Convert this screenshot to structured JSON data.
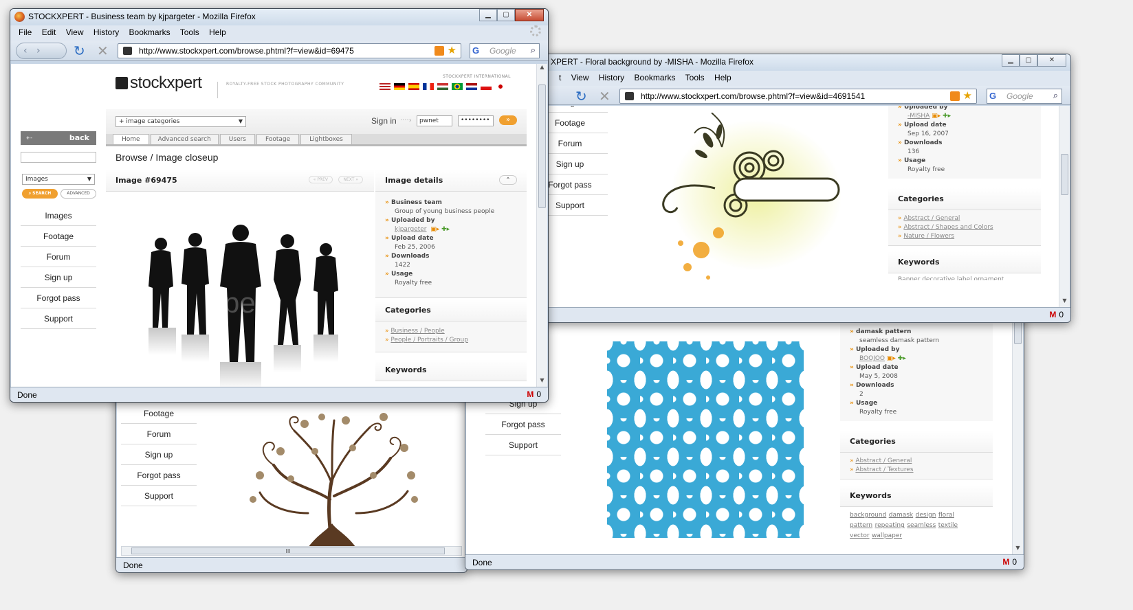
{
  "windows": {
    "bottom_left": {
      "status": "Done",
      "leftnav": [
        "Footage",
        "Forum",
        "Sign up",
        "Forgot pass",
        "Support"
      ],
      "hscroll_grip": "III"
    },
    "bottom_right": {
      "status": "Done",
      "gmail_count": "0",
      "leftnav": [
        "Sign up",
        "Forgot pass",
        "Support"
      ],
      "details": {
        "title": "damask pattern",
        "description": "seamless damask pattern",
        "uploaded_by_label": "Uploaded by",
        "uploaded_by": "BOOJOO",
        "upload_date_label": "Upload date",
        "upload_date": "May 5, 2008",
        "downloads_label": "Downloads",
        "downloads": "2",
        "usage_label": "Usage",
        "usage": "Royalty free"
      },
      "categories_title": "Categories",
      "categories": [
        "Abstract / General",
        "Abstract / Textures"
      ],
      "keywords_title": "Keywords",
      "keywords": [
        "background",
        "damask",
        "design",
        "floral",
        "pattern",
        "repeating",
        "seamless",
        "textile",
        "vector",
        "wallpaper"
      ]
    },
    "middle": {
      "title": "STOCKXPERT - Floral background by -MISHA - Mozilla Firefox",
      "title_visible": "XPERT - Floral background by -MISHA - Mozilla Firefox",
      "menu": [
        "t",
        "View",
        "History",
        "Bookmarks",
        "Tools",
        "Help"
      ],
      "url": "http://www.stockxpert.com/browse.phtml?f=view&id=4691541",
      "search_placeholder": "Google",
      "leftnav": [
        "Images",
        "Footage",
        "Forum",
        "Sign up",
        "Forgot pass",
        "Support"
      ],
      "details": {
        "uploaded_by_label": "Uploaded by",
        "uploaded_by": "-MISHA",
        "upload_date_label": "Upload date",
        "upload_date": "Sep 16, 2007",
        "downloads_label": "Downloads",
        "downloads": "136",
        "usage_label": "Usage",
        "usage": "Royalty free"
      },
      "categories_title": "Categories",
      "categories": [
        "Abstract / General",
        "Abstract / Shapes and Colors",
        "Nature / Flowers"
      ],
      "keywords_title": "Keywords",
      "keywords_peek": "Banner decorative label ornament",
      "status": "",
      "gmail_count": "0"
    },
    "front": {
      "title": "STOCKXPERT - Business team by kjpargeter - Mozilla Firefox",
      "menu": [
        "File",
        "Edit",
        "View",
        "History",
        "Bookmarks",
        "Tools",
        "Help"
      ],
      "url": "http://www.stockxpert.com/browse.phtml?f=view&id=69475",
      "search_placeholder": "Google",
      "status": "Done",
      "gmail_count": "0",
      "site": {
        "logo_text": "stockxpert",
        "tagline": "ROYALTY-FREE STOCK PHOTOGRAPHY COMMUNITY",
        "intl_label": "STOCKXPERT INTERNATIONAL",
        "back_label": "back",
        "search_type": "Images",
        "search_button": "SEARCH",
        "advanced_button": "ADVANCED",
        "categories_dropdown": "+ image categories",
        "sign_in_label": "Sign in",
        "sign_in_arrow": "····›",
        "username": "pwnet",
        "password": "••••••••",
        "go_arrow": "»",
        "tabs": [
          "Home",
          "Advanced search",
          "Users",
          "Footage",
          "Lightboxes"
        ],
        "breadcrumb": "Browse / Image closeup",
        "image_heading": "Image #69475",
        "prev_label": "« PREV",
        "next_label": "NEXT »",
        "watermark": "xpert",
        "leftnav": [
          "Images",
          "Footage",
          "Forum",
          "Sign up",
          "Forgot pass",
          "Support"
        ],
        "details_title": "Image details",
        "details": {
          "title": "Business team",
          "description": "Group of young business people",
          "uploaded_by_label": "Uploaded by",
          "uploaded_by": "kjpargeter",
          "upload_date_label": "Upload date",
          "upload_date": "Feb 25, 2006",
          "downloads_label": "Downloads",
          "downloads": "1422",
          "usage_label": "Usage",
          "usage": "Royalty free"
        },
        "categories_title": "Categories",
        "categories": [
          "Business / People",
          "People / Portraits / Group"
        ],
        "keywords_title": "Keywords"
      }
    }
  },
  "colors": {
    "accent_orange": "#e88b00",
    "chrome_blue": "#c8d6e6",
    "damask_blue": "#3aa9d6",
    "tree_brown": "#5a3a22"
  }
}
